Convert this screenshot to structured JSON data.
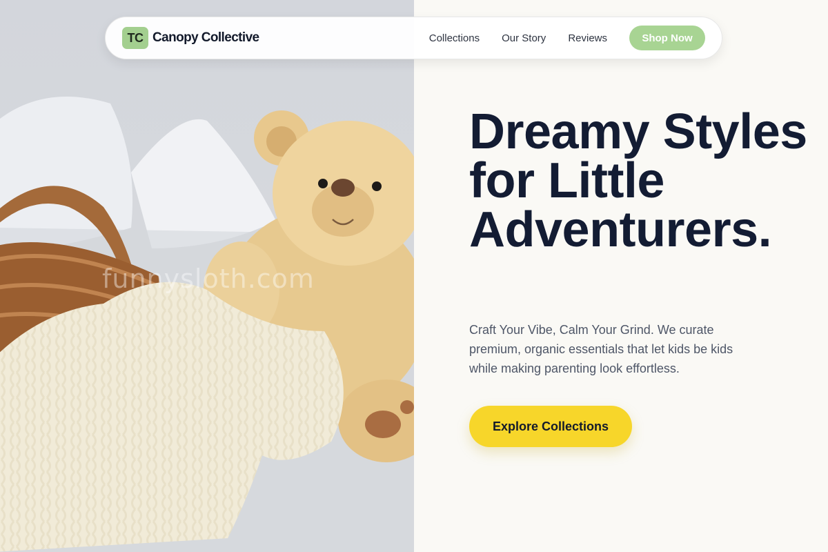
{
  "brand": {
    "logo_initials": "TC",
    "name": "Canopy Collective"
  },
  "nav": {
    "items": [
      {
        "label": "Collections"
      },
      {
        "label": "Our Story"
      },
      {
        "label": "Reviews"
      }
    ],
    "cta_label": "Shop Now"
  },
  "hero": {
    "headline": "Dreamy Styles for Little Adventurers.",
    "subtext": "Craft Your Vibe, Calm Your Grind. We curate premium, organic essentials that let kids be kids while making parenting look effortless.",
    "cta_label": "Explore Collections",
    "image_watermark": "funnysloth.com"
  },
  "colors": {
    "accent_green": "#a8d493",
    "cta_yellow": "#f7d62a",
    "headline_navy": "#131c33",
    "panel_background": "#faf9f5"
  }
}
